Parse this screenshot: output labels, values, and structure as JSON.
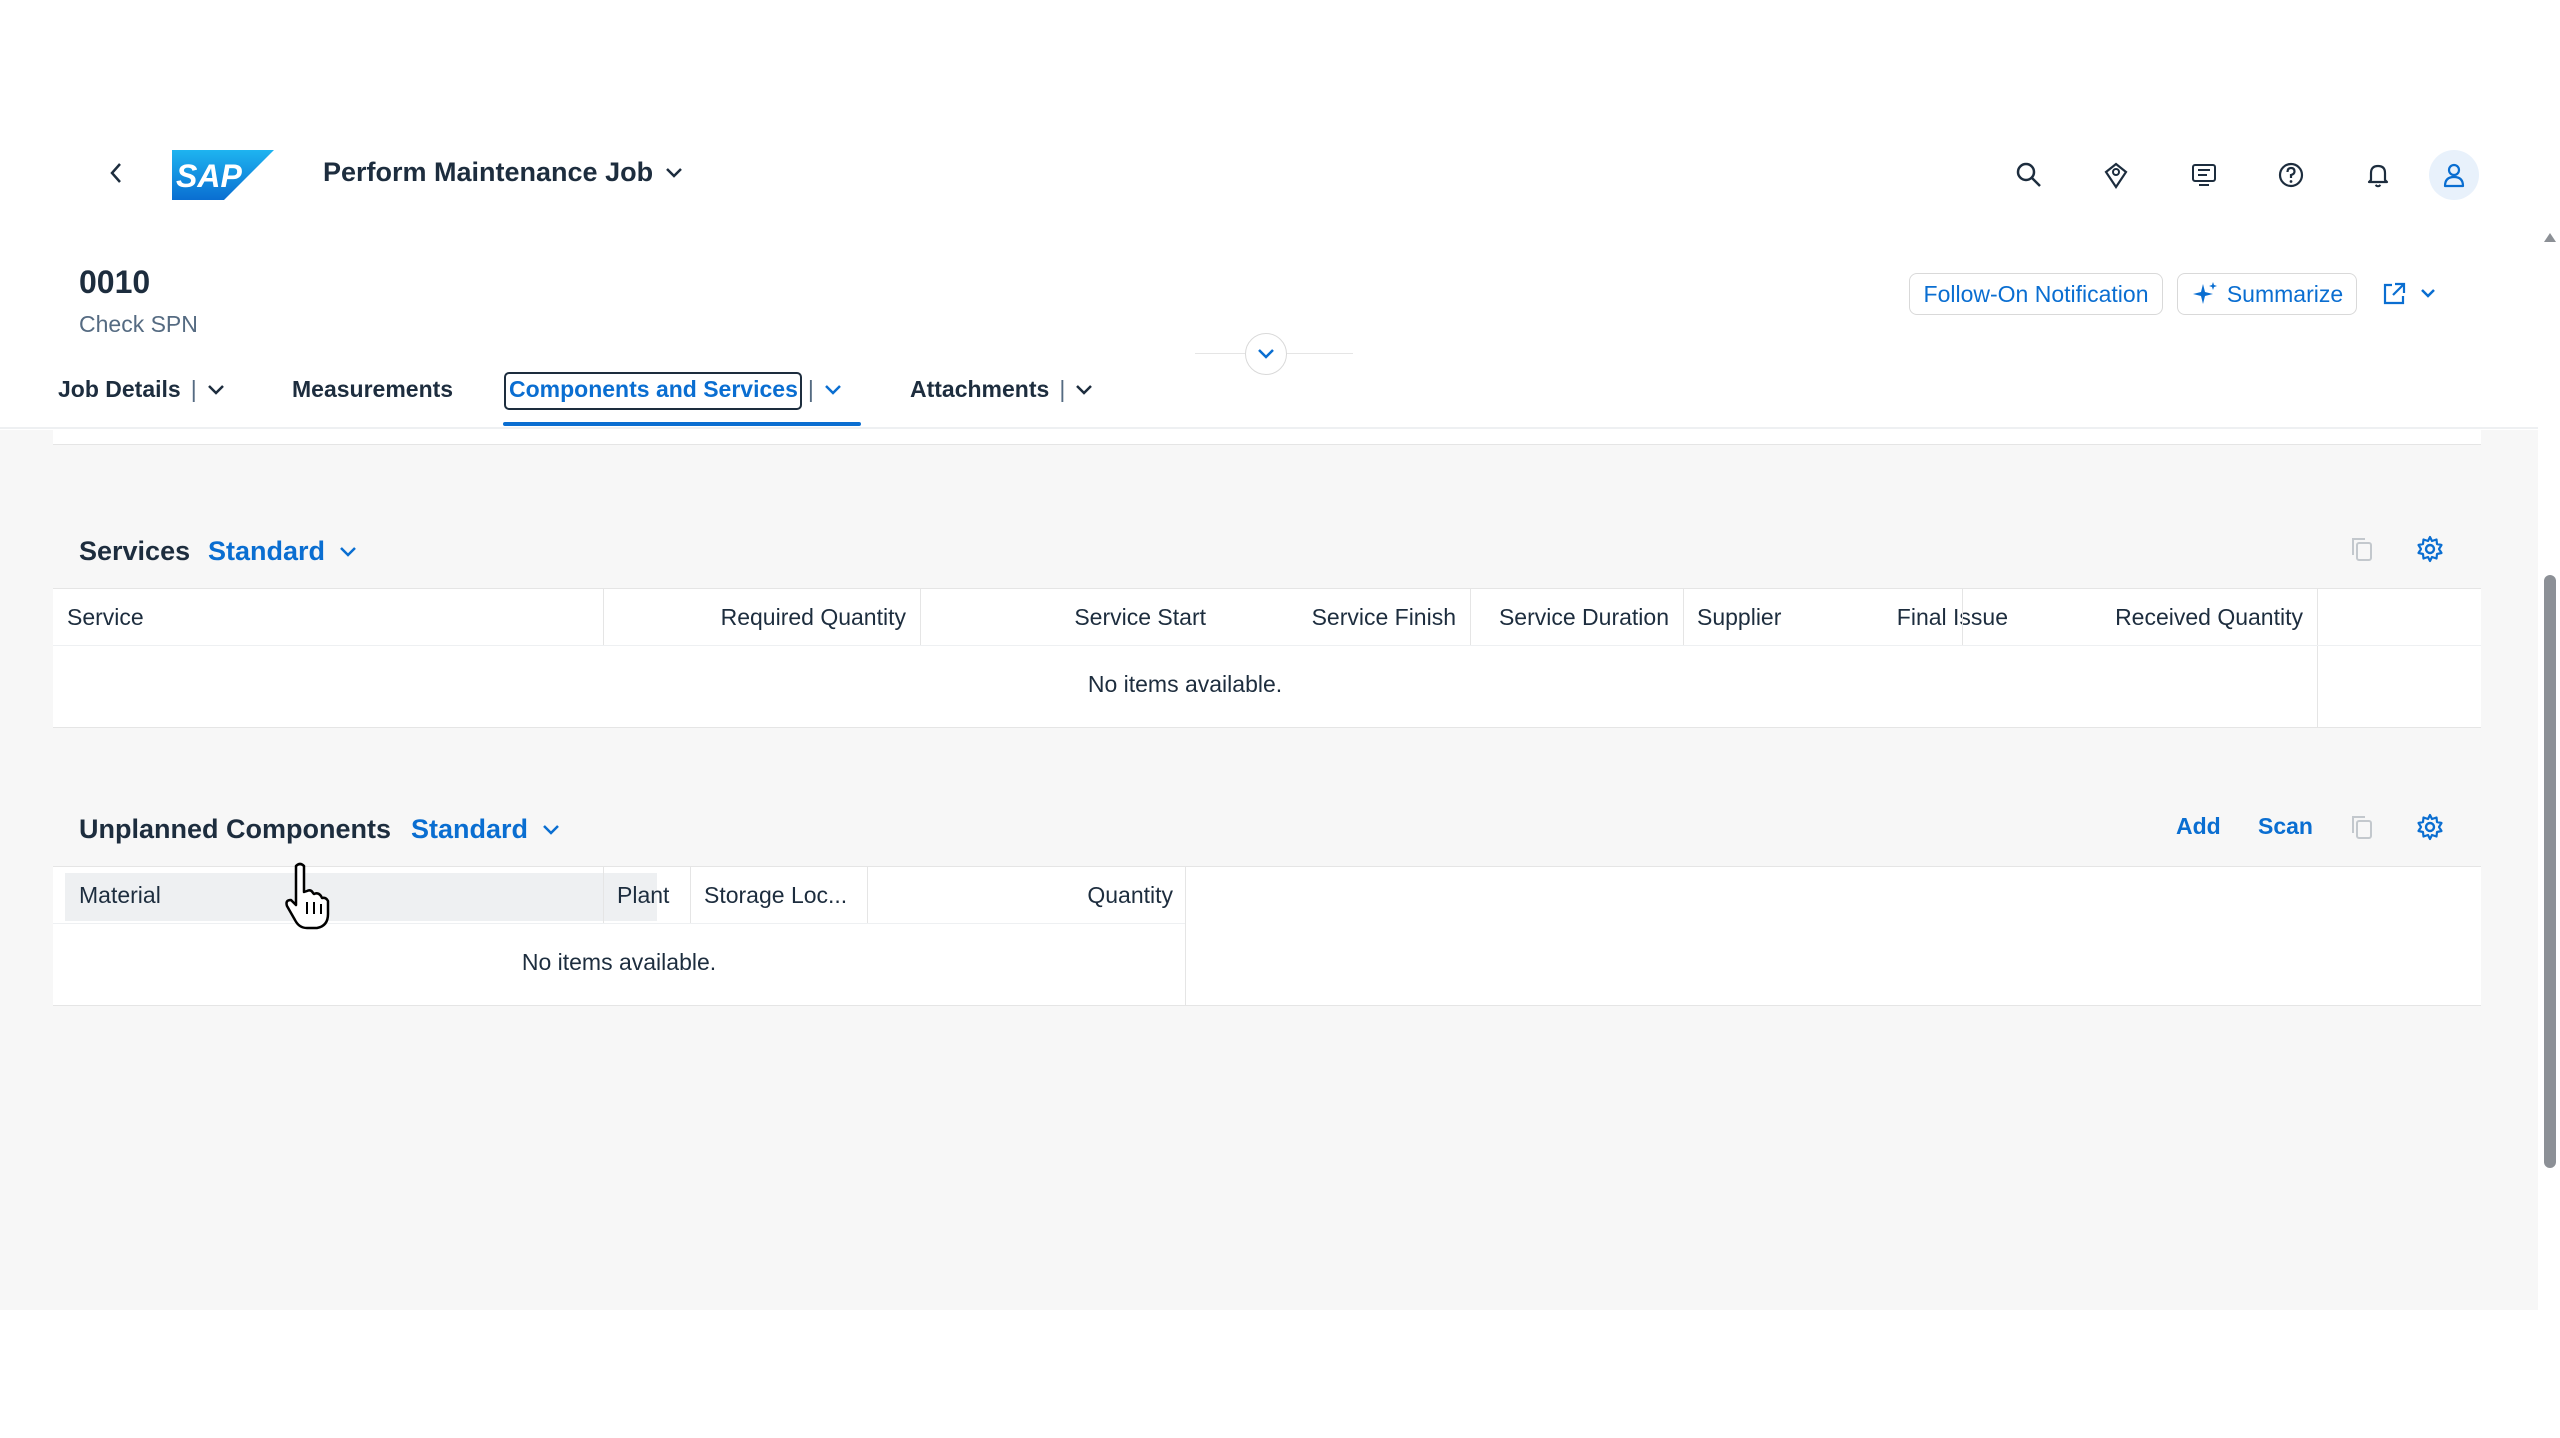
{
  "shell": {
    "app_title": "Perform Maintenance Job",
    "logo_text": "SAP",
    "icons": [
      "back-icon",
      "search-icon",
      "joule-icon",
      "menu-icon",
      "help-icon",
      "bell-icon",
      "user-icon"
    ]
  },
  "object": {
    "id": "0010",
    "subtitle": "Check SPN",
    "actions": {
      "follow_on": "Follow-On Notification",
      "summarize": "Summarize"
    }
  },
  "tabs": [
    {
      "label": "Job Details",
      "has_menu": true
    },
    {
      "label": "Measurements",
      "has_menu": false
    },
    {
      "label": "Components and Services",
      "has_menu": true,
      "selected": true
    },
    {
      "label": "Attachments",
      "has_menu": true
    }
  ],
  "services": {
    "title": "Services",
    "variant": "Standard",
    "columns": [
      "Service",
      "Required Quantity",
      "Service Start",
      "Service Finish",
      "Service Duration",
      "Supplier",
      "Final Issue",
      "Received Quantity"
    ],
    "empty_text": "No items available."
  },
  "unplanned": {
    "title": "Unplanned Components",
    "variant": "Standard",
    "add_label": "Add",
    "scan_label": "Scan",
    "columns": [
      "Material",
      "Plant",
      "Storage Loc...",
      "Quantity"
    ],
    "empty_text": "No items available."
  },
  "colors": {
    "brand_blue": "#0a6ed1",
    "text": "#1d2d3e",
    "background": "#f7f7f7"
  }
}
